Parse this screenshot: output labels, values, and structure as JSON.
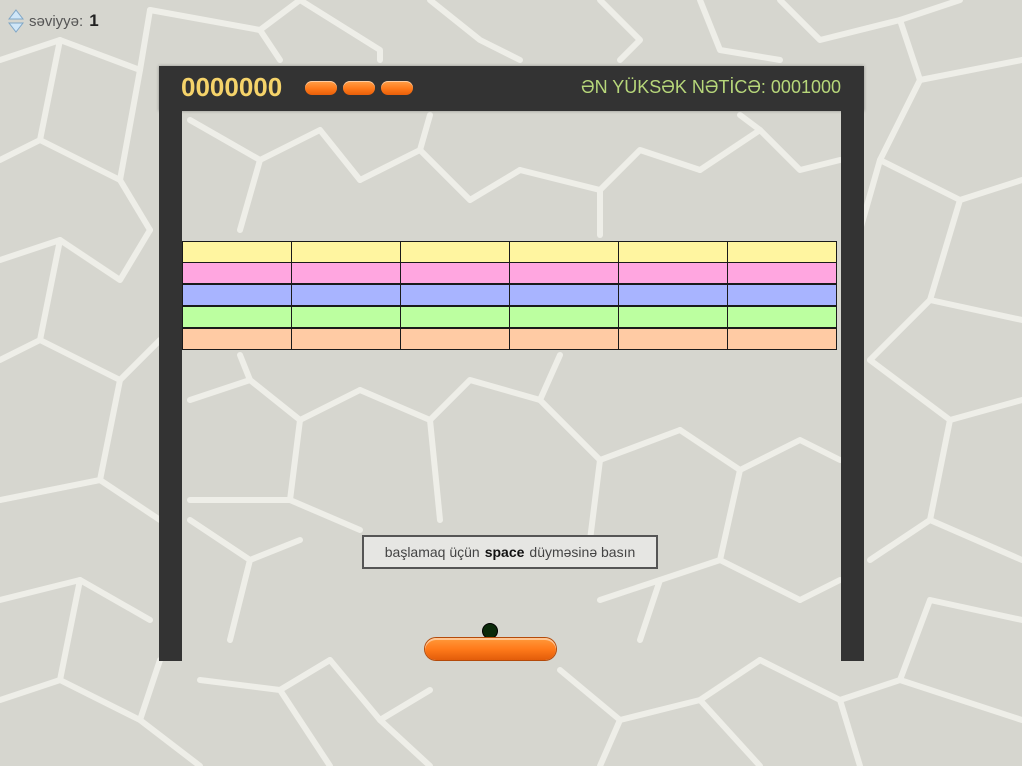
{
  "level": {
    "label": "səviyyə:",
    "value": "1"
  },
  "hud": {
    "score": "0000000",
    "lives_remaining": 3,
    "high_score_text": "ƏN YÜKSƏK NƏTİCƏ: 0001000"
  },
  "bricks": {
    "rows": [
      {
        "color": "#fff5a0",
        "count": 6
      },
      {
        "color": "#ffa6e0",
        "count": 6
      },
      {
        "color": "#a8b4ff",
        "count": 6
      },
      {
        "color": "#bcffa0",
        "count": 6
      },
      {
        "color": "#ffcba4",
        "count": 6
      }
    ]
  },
  "start_message": {
    "before": "başlamaq üçün",
    "key": "space",
    "after": "düyməsinə basın"
  },
  "colors": {
    "frame": "#333333",
    "score": "#f5d36a",
    "high_score": "#b7d77a",
    "paddle": "#ff7a1a",
    "ball": "#0b2a0b"
  }
}
